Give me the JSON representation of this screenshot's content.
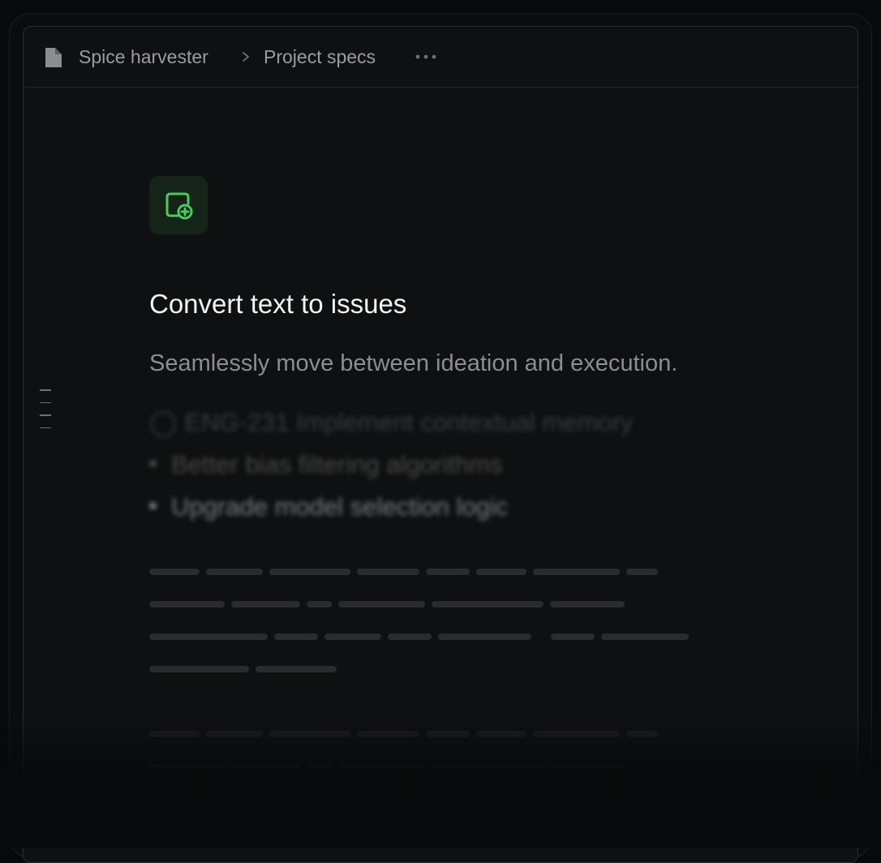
{
  "breadcrumb": {
    "items": [
      "Spice harvester",
      "Project specs"
    ],
    "separator_icon": "chevron-right-icon",
    "more_icon": "ellipsis-icon"
  },
  "feature": {
    "icon": "add-issue-icon",
    "accent_color": "#4cc95e",
    "title": "Convert text to issues",
    "description": "Seamlessly move between ideation and execution."
  },
  "document": {
    "blurred_lines": [
      "ENG-231 Implement contextual memory",
      "Better bias filtering algorithms",
      "Upgrade model selection logic"
    ]
  },
  "colors": {
    "background": "#08090a",
    "window": "#0f1012",
    "border": "#2b2c30",
    "text_primary": "#f2f3f5",
    "text_secondary": "#8c8d92"
  }
}
